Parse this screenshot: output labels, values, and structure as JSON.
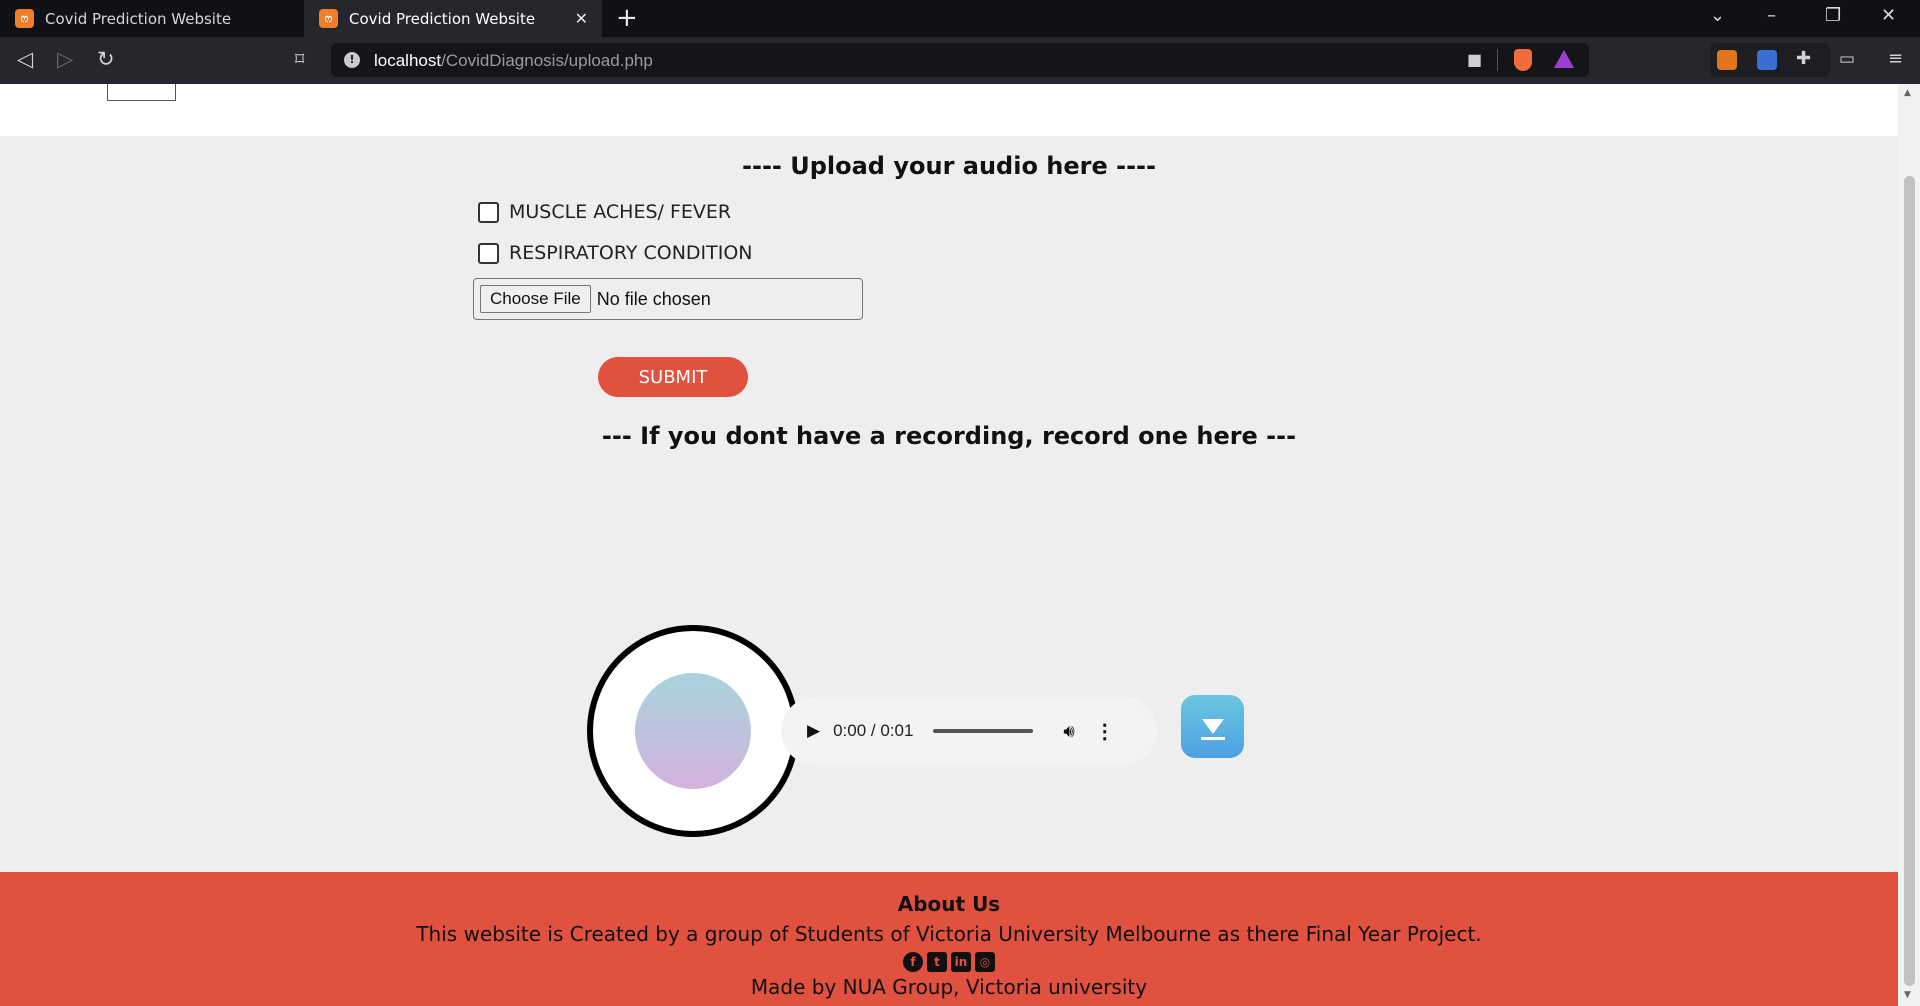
{
  "browser": {
    "tabs": [
      {
        "label": "Covid Prediction Website",
        "active": false
      },
      {
        "label": "Covid Prediction Website",
        "active": true
      }
    ],
    "url_host": "localhost",
    "url_path": "/CovidDiagnosis/upload.php",
    "icons": [
      "back-icon",
      "forward-icon",
      "reload-icon",
      "bookmark-icon",
      "site-info-icon",
      "camera-icon",
      "brave-shield-icon",
      "brave-rewards-icon",
      "extension-icon",
      "wallet-icon",
      "menu-icon"
    ]
  },
  "upload": {
    "heading": "---- Upload your audio here ----",
    "checkbox_1": "MUSCLE ACHES/ FEVER",
    "checkbox_2": "RESPIRATORY CONDITION",
    "choose_file": "Choose File",
    "no_file": "No file chosen",
    "submit": "SUBMIT"
  },
  "record": {
    "heading": "--- If you dont have a recording, record one here ---",
    "audio_time": "0:00 / 0:01"
  },
  "footer": {
    "title": "About Us",
    "description": "This website is Created by a group of Students of Victoria University Melbourne as there Final Year Project.",
    "social_icons": [
      "facebook-icon",
      "twitter-icon",
      "linkedin-icon",
      "instagram-icon"
    ],
    "made_by": "Made by NUA Group, Victoria university"
  },
  "colors": {
    "accent": "#e05140",
    "page_bg": "#eeeeee",
    "browser_chrome": "#25272d"
  }
}
